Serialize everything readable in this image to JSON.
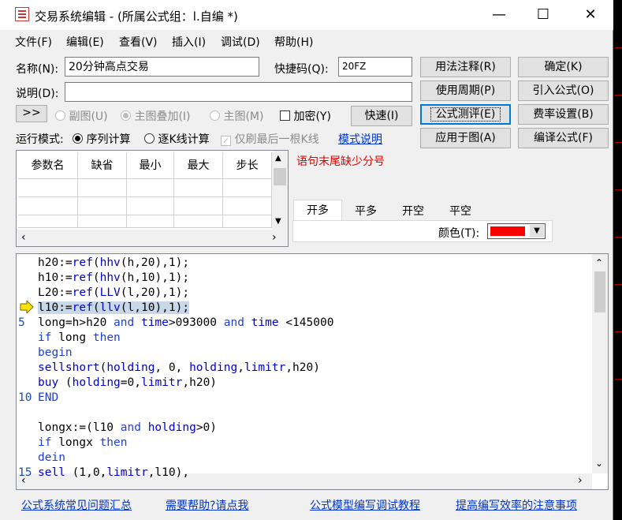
{
  "window": {
    "title": "交易系统编辑 - (所属公式组：l.自编 *)",
    "minimize_glyph": "—",
    "maximize_glyph": "☐",
    "close_glyph": "✕"
  },
  "menu": [
    "文件(F)",
    "编辑(E)",
    "查看(V)",
    "插入(I)",
    "调试(D)",
    "帮助(H)"
  ],
  "form": {
    "name_label": "名称(N):",
    "name_value": "20分钟高点交易",
    "shortcut_label": "快捷码(Q):",
    "shortcut_value": "20FZ",
    "desc_label": "说明(D):",
    "desc_value": "",
    "expand_btn": ">>",
    "radio_subchart": "副图(U)",
    "radio_main_overlay": "主图叠加(I)",
    "radio_main": "主图(M)",
    "encrypt_label": "加密(Y)",
    "fast_btn": "快速(I)",
    "run_mode_label": "运行模式:",
    "mode_serial": "序列计算",
    "mode_kline": "逐K线计算",
    "refresh_last_label": "仅刷最后一根K线",
    "mode_help_link": "模式说明",
    "error_message": "语句末尾缺少分号"
  },
  "buttons": {
    "usage_notes": "用法注释(R)",
    "ok": "确定(K)",
    "use_period": "使用周期(P)",
    "import_formula": "引入公式(O)",
    "formula_test": "公式测评(E)",
    "fee_settings": "费率设置(B)",
    "apply_to_chart": "应用于图(A)",
    "compile_formula": "编译公式(F)"
  },
  "param_table": {
    "columns": [
      "参数名",
      "缺省",
      "最小",
      "最大",
      "步长"
    ],
    "rows": [
      [
        "",
        "",
        "",
        "",
        ""
      ],
      [
        "",
        "",
        "",
        "",
        ""
      ],
      [
        "",
        "",
        "",
        "",
        ""
      ]
    ]
  },
  "signal_tabs": [
    "开多",
    "平多",
    "开空",
    "平空"
  ],
  "color_label": "颜色(T):",
  "signal_color": "#ff0000",
  "code_lines": [
    {
      "no": "",
      "text": "h20:=ref(hhv(h,20),1);"
    },
    {
      "no": "",
      "text": "h10:=ref(hhv(h,10),1);"
    },
    {
      "no": "",
      "text": "L20:=ref(LLV(l,20),1);"
    },
    {
      "no": "",
      "text": "l10:=ref(llv(l,10),1);"
    },
    {
      "no": "5",
      "text": "long=h>h20 and time>093000 and time <145000"
    },
    {
      "no": "",
      "text": "if long then"
    },
    {
      "no": "",
      "text": "begin"
    },
    {
      "no": "",
      "text": "sellshort(holding, 0, holding,limitr,h20)"
    },
    {
      "no": "",
      "text": "buy (holding=0,limitr,h20)"
    },
    {
      "no": "10",
      "text": "END"
    },
    {
      "no": "",
      "text": ""
    },
    {
      "no": "",
      "text": "longx:=(l10 and holding>0)"
    },
    {
      "no": "",
      "text": "if longx then"
    },
    {
      "no": "",
      "text": "dein"
    },
    {
      "no": "15",
      "text": "sell (1,0,limitr,l10),"
    }
  ],
  "footer_links": [
    "公式系统常见问题汇总",
    "需要帮助?请点我",
    "公式模型编写调试教程",
    "提高编写效率的注意事项"
  ]
}
